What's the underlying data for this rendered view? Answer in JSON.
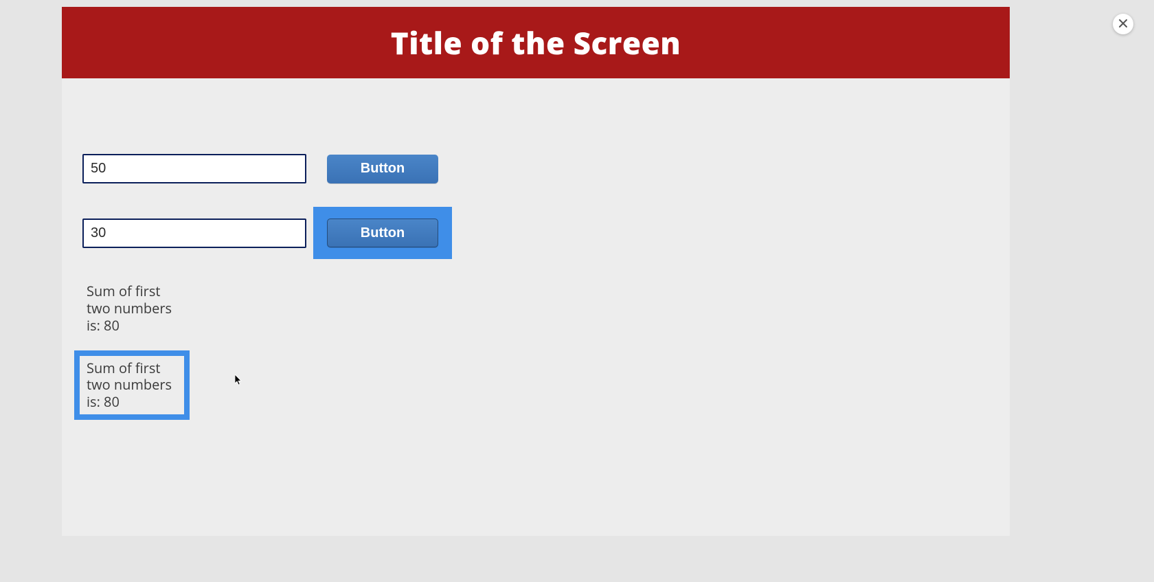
{
  "header": {
    "title": "Title of the Screen"
  },
  "inputs": {
    "first_value": "50",
    "second_value": "30"
  },
  "buttons": {
    "first_label": "Button",
    "second_label": "Button"
  },
  "output": {
    "sum_text_1": "Sum of first two numbers is: 80",
    "sum_text_2": "Sum of first two numbers is: 80"
  },
  "icons": {
    "close": "close-icon"
  }
}
